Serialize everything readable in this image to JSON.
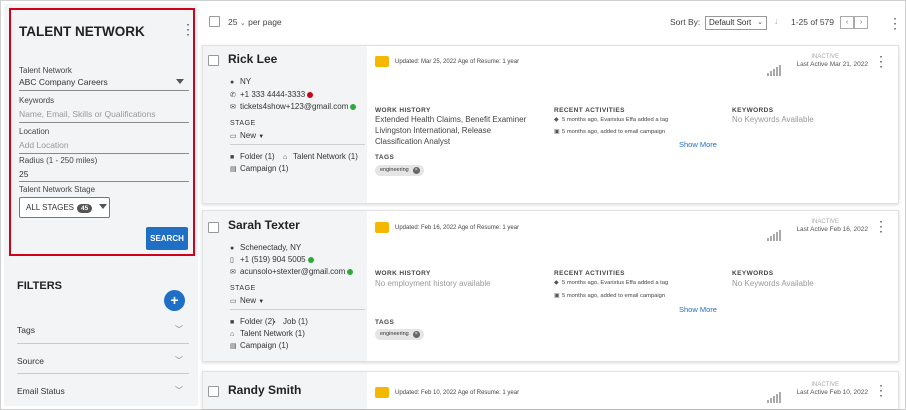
{
  "sidebar": {
    "talent_network_title": "TALENT NETWORK",
    "talent_network_label": "Talent Network",
    "talent_network_value": "ABC Company Careers",
    "keywords_label": "Keywords",
    "keywords_placeholder": "Name, Email, Skills or Qualifications",
    "location_label": "Location",
    "location_placeholder": "Add Location",
    "radius_label": "Radius (1 - 250 miles)",
    "radius_value": "25",
    "stage_label": "Talent Network Stage",
    "stage_value": "ALL STAGES",
    "stage_count": "45",
    "search_label": "SEARCH",
    "filters_title": "FILTERS",
    "filter_items": [
      {
        "label": "Tags"
      },
      {
        "label": "Source"
      },
      {
        "label": "Email Status"
      }
    ]
  },
  "topbar": {
    "per_page_value": "25",
    "per_page_label": "per page",
    "sort_by_label": "Sort By:",
    "sort_value": "Default Sort",
    "range_text": "1-25 of 579"
  },
  "candidates": [
    {
      "name": "Rick Lee",
      "location": "NY",
      "phone": "+1 333 4444-3333",
      "email": "tickets4show+123@gmail.com",
      "stage_label": "STAGE",
      "stage_value": "New",
      "folder_text": "Folder (1)",
      "network_text": "Talent Network (1)",
      "campaign_text": "Campaign (1)",
      "updated_text": "Updated: Mar 25, 2022 Age of Resume: 1 year",
      "status": "INACTIVE",
      "last_active": "Last Active Mar 21, 2022",
      "work_history_label": "WORK HISTORY",
      "work_history": "Extended Health Claims, Benefit Examiner",
      "work_history_2": "Livingston International, Release",
      "work_history_3": "Classification Analyst",
      "recent_label": "RECENT ACTIVITIES",
      "activity_1": "5 months ago, Evaristus Effa added a tag",
      "activity_2": "5 months ago, added to email campaign",
      "show_more": "Show More",
      "keywords_label": "KEYWORDS",
      "keywords_value": "No Keywords Available",
      "tags_label": "TAGS",
      "tag": "engineering"
    },
    {
      "name": "Sarah Texter",
      "location": "Schenectady, NY",
      "phone": "+1 (519) 904 5005",
      "email": "acunsolo+stexter@gmail.com",
      "stage_label": "STAGE",
      "stage_value": "New",
      "folder_text": "Folder (2)",
      "job_text": "Job (1)",
      "network_text": "Talent Network (1)",
      "campaign_text": "Campaign (1)",
      "updated_text": "Updated: Feb 16, 2022 Age of Resume: 1 year",
      "status": "INACTIVE",
      "last_active": "Last Active Feb 16, 2022",
      "work_history_label": "WORK HISTORY",
      "work_history": "No employment history available",
      "recent_label": "RECENT ACTIVITIES",
      "activity_1": "5 months ago, Evaristus Effa added a tag",
      "activity_2": "5 months ago, added to email campaign",
      "show_more": "Show More",
      "keywords_label": "KEYWORDS",
      "keywords_value": "No Keywords Available",
      "tags_label": "TAGS",
      "tag": "engineering"
    },
    {
      "name": "Randy Smith",
      "updated_text": "Updated: Feb 10, 2022 Age of Resume: 1 year",
      "status": "INACTIVE",
      "last_active": "Last Active Feb 10, 2022"
    }
  ],
  "colors": {
    "accent_blue": "#1f6fc5",
    "highlight_red": "#d0021b",
    "resume_icon": "#f5b800"
  }
}
